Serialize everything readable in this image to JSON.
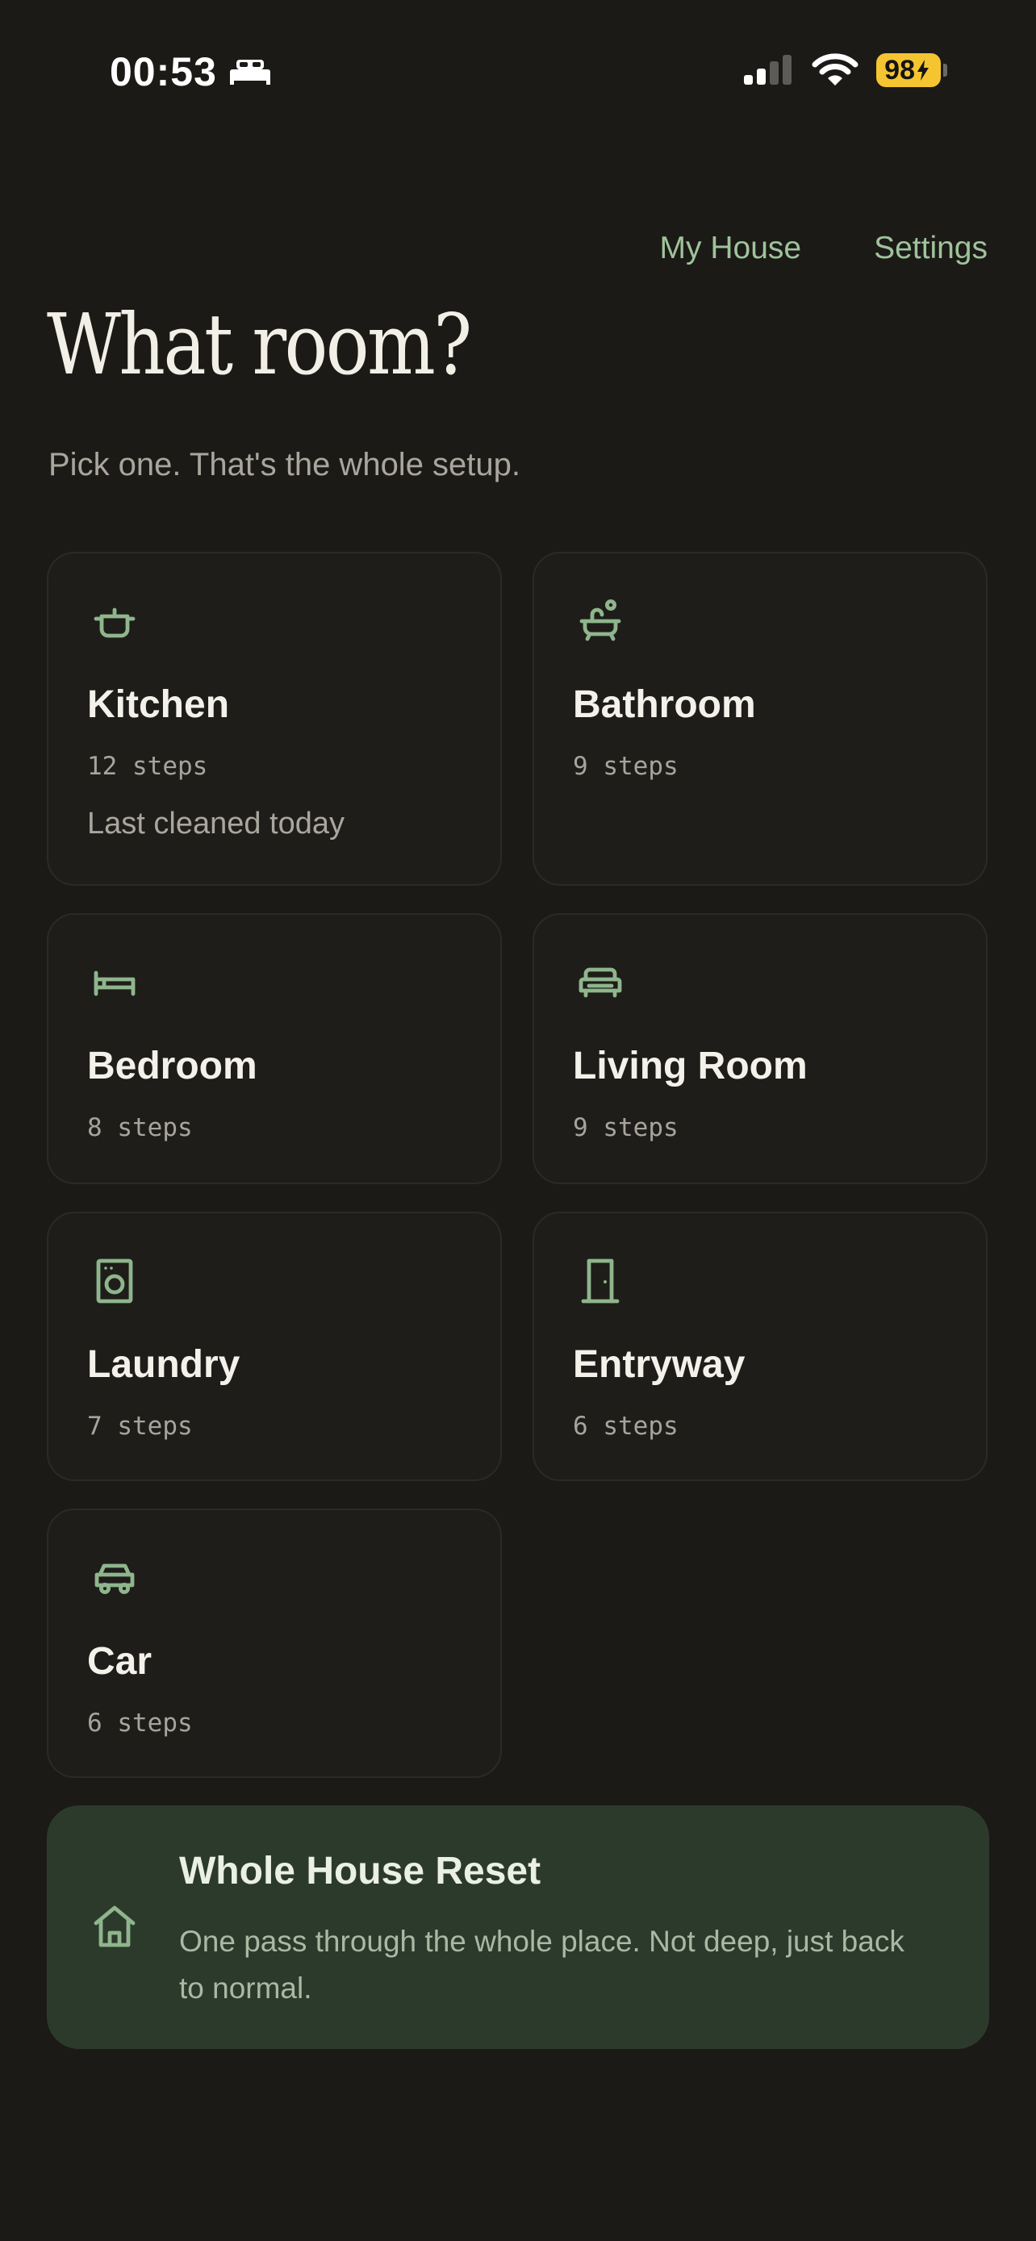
{
  "status_bar": {
    "time": "00:53",
    "battery": "98"
  },
  "nav": {
    "my_house": "My House",
    "settings": "Settings"
  },
  "header": {
    "title": "What room?",
    "subtitle": "Pick one. That's the whole setup."
  },
  "rooms": [
    {
      "name": "Kitchen",
      "steps": "12 steps",
      "note": "Last cleaned today",
      "icon": "pot-icon"
    },
    {
      "name": "Bathroom",
      "steps": "9 steps",
      "icon": "bathtub-icon"
    },
    {
      "name": "Bedroom",
      "steps": "8 steps",
      "icon": "bed-icon"
    },
    {
      "name": "Living Room",
      "steps": "9 steps",
      "icon": "sofa-icon"
    },
    {
      "name": "Laundry",
      "steps": "7 steps",
      "icon": "washing-machine-icon"
    },
    {
      "name": "Entryway",
      "steps": "6 steps",
      "icon": "door-icon"
    },
    {
      "name": "Car",
      "steps": "6 steps",
      "icon": "car-icon"
    }
  ],
  "reset": {
    "title": "Whole House Reset",
    "description": "One pass through the whole place. Not deep, just back to normal.",
    "icon": "house-icon"
  },
  "colors": {
    "background": "#1b1a17",
    "accent": "#8fb58c",
    "card": "#1e1d1a",
    "reset_card": "#2c3a2c",
    "battery": "#f4c531"
  }
}
